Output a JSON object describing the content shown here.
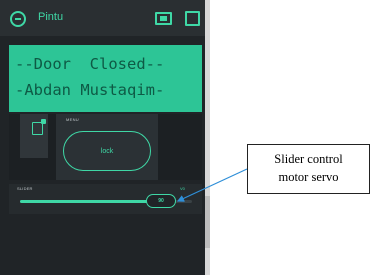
{
  "header": {
    "title": "Pintu",
    "back_icon": "back-circle-icon",
    "device_icon": "device-icon",
    "stop_icon": "stop-icon"
  },
  "lcd": {
    "line1": "--Door  Closed--",
    "line2": "-Abdan Mustaqim-"
  },
  "button_widget": {
    "label": "MENU",
    "button_text": "lock"
  },
  "slider": {
    "label": "SLIDER",
    "value_label": "V0",
    "value_text": "90",
    "level_fraction": 0.82
  },
  "annotation": {
    "text_line1": "Slider control",
    "text_line2": "motor servo"
  },
  "colors": {
    "accent": "#3fd8a6",
    "lcd_background": "#2dc596",
    "app_background": "#202427"
  }
}
